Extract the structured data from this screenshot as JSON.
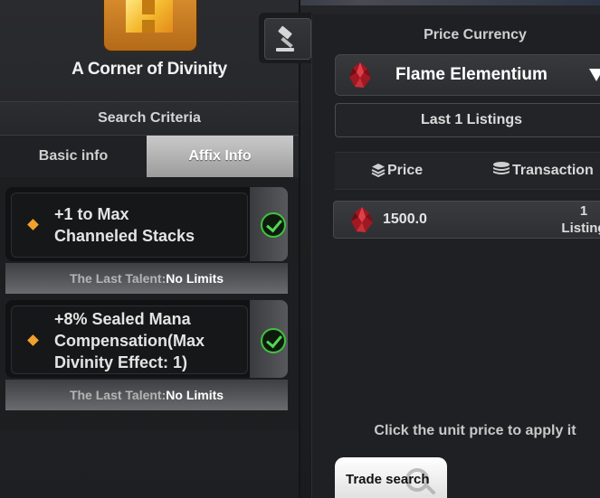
{
  "item": {
    "name": "A Corner of Divinity",
    "icon": "golden-item-icon"
  },
  "auction_button": {
    "icon": "gavel-icon"
  },
  "search": {
    "title": "Search Criteria",
    "tabs": [
      {
        "label": "Basic info",
        "active": false
      },
      {
        "label": "Affix Info",
        "active": true
      }
    ]
  },
  "affixes": [
    {
      "lines": [
        "+1 to Max",
        "Channeled Stacks"
      ],
      "checked": true,
      "talent_label": "The Last Talent:",
      "talent_value": "No Limits"
    },
    {
      "lines": [
        "+8% Sealed Mana",
        "Compensation(Max",
        "Divinity Effect: 1)"
      ],
      "checked": true,
      "talent_label": "The Last Talent:",
      "talent_value": "No Limits"
    }
  ],
  "price_currency": {
    "title": "Price Currency",
    "selected": "Flame Elementium",
    "icon": "flame-elementium-icon"
  },
  "listings_filter": "Last 1 Listings",
  "columns": [
    {
      "label": "Price",
      "icon": "stack-icon"
    },
    {
      "label": "Transaction",
      "icon": "coins-icon"
    }
  ],
  "listings": [
    {
      "price": "1500.0",
      "count_line1": "1",
      "count_line2": "Listing"
    }
  ],
  "hint": "Click the unit price to apply it",
  "trade_search": {
    "label": "Trade search",
    "icon": "search-icon"
  },
  "colors": {
    "accent_orange": "#f2a22a",
    "check_green": "#3ec43e",
    "gem_red": "#c0202a"
  }
}
